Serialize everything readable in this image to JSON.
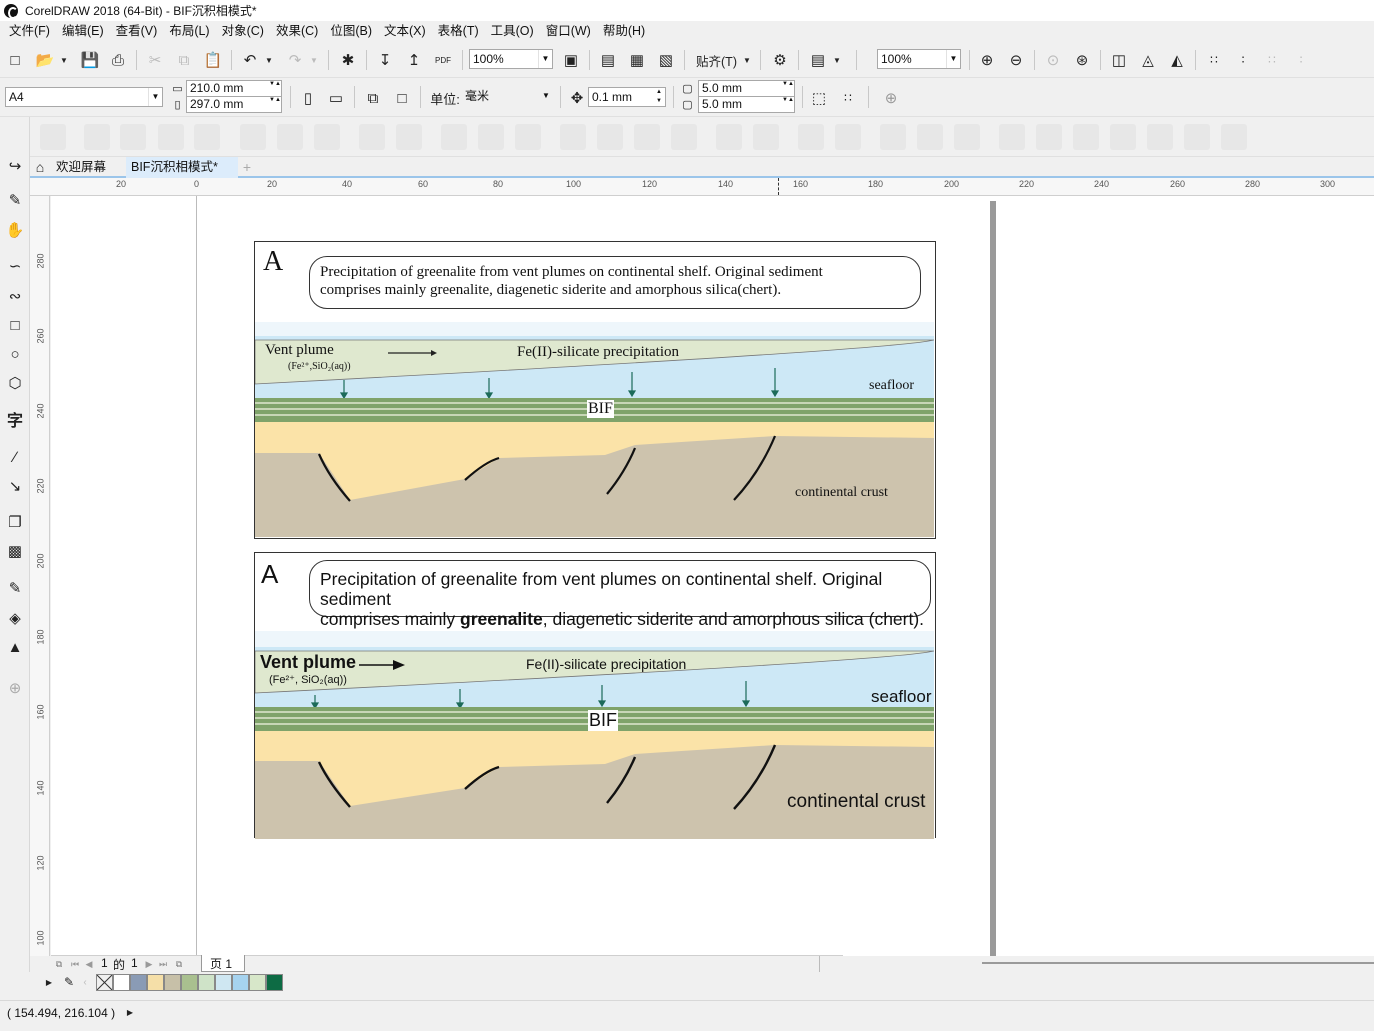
{
  "window": {
    "title": "CorelDRAW 2018 (64-Bit) - BIF沉积相模式*"
  },
  "menu": [
    "文件(F)",
    "编辑(E)",
    "查看(V)",
    "布局(L)",
    "对象(C)",
    "效果(C)",
    "位图(B)",
    "文本(X)",
    "表格(T)",
    "工具(O)",
    "窗口(W)",
    "帮助(H)"
  ],
  "toolbar1": {
    "zoom1": "100%",
    "snap_label": "贴齐(T)",
    "zoom2": "100%",
    "pdf": "PDF"
  },
  "toolbar2": {
    "page_size": "A4",
    "width": "210.0 mm",
    "height": "297.0 mm",
    "unit_label": "单位:",
    "unit": "毫米",
    "nudge": "0.1 mm",
    "dup_x": "5.0 mm",
    "dup_y": "5.0 mm"
  },
  "tabs": {
    "welcome": "欢迎屏幕",
    "doc": "BIF沉积相模式*"
  },
  "hruler": [
    "20",
    "0",
    "20",
    "40",
    "60",
    "80",
    "100",
    "120",
    "140",
    "160",
    "180",
    "200",
    "220",
    "240",
    "260",
    "280",
    "300"
  ],
  "vruler": [
    "280",
    "260",
    "240",
    "220",
    "200",
    "180",
    "160",
    "140",
    "120",
    "100"
  ],
  "pagenav": {
    "current": "1",
    "of": "的",
    "total": "1",
    "page_tab": "页 1"
  },
  "status": {
    "coords": "( 154.494, 216.104 )"
  },
  "palette": [
    "#ffffff",
    "#ffffff",
    "#8a9bb5",
    "#f5dfa8",
    "#c7c0a8",
    "#a9c08f",
    "#cfe3c8",
    "#cfe7f2",
    "#a6d3ef",
    "#d7e7c9",
    "#0d6b44"
  ],
  "figure": {
    "panel1": {
      "letter": "A",
      "caption1": "Precipitation of greenalite from vent plumes on continental shelf. Original sediment",
      "caption2": "comprises mainly greenalite, diagenetic siderite and amorphous silica(chert).",
      "vent": "Vent plume",
      "vent_sub": "(Fe²⁺,SiO₂(aq))",
      "precip": "Fe(II)-silicate precipitation",
      "seafloor": "seafloor",
      "bif": "BIF",
      "crust": "continental crust"
    },
    "panel2": {
      "letter": "A",
      "caption1": "Precipitation of greenalite from vent plumes on continental shelf. Original sediment",
      "caption2a": "comprises mainly ",
      "caption2b": "greenalite",
      "caption2c": ", diagenetic siderite and amorphous silica (chert).",
      "vent": "Vent plume",
      "vent_sub": "(Fe²⁺, SiO₂(aq))",
      "precip": "Fe(II)-silicate precipitation",
      "seafloor": "seafloor",
      "bif": "BIF",
      "crust": "continental crust"
    }
  },
  "colors": {
    "water": "#cde8f6",
    "plume": "#dfe8cf",
    "bif_green": "#7fa36a",
    "sand": "#fbe3a8",
    "crust": "#cdc3ad",
    "accent": "#3d8fd6"
  }
}
